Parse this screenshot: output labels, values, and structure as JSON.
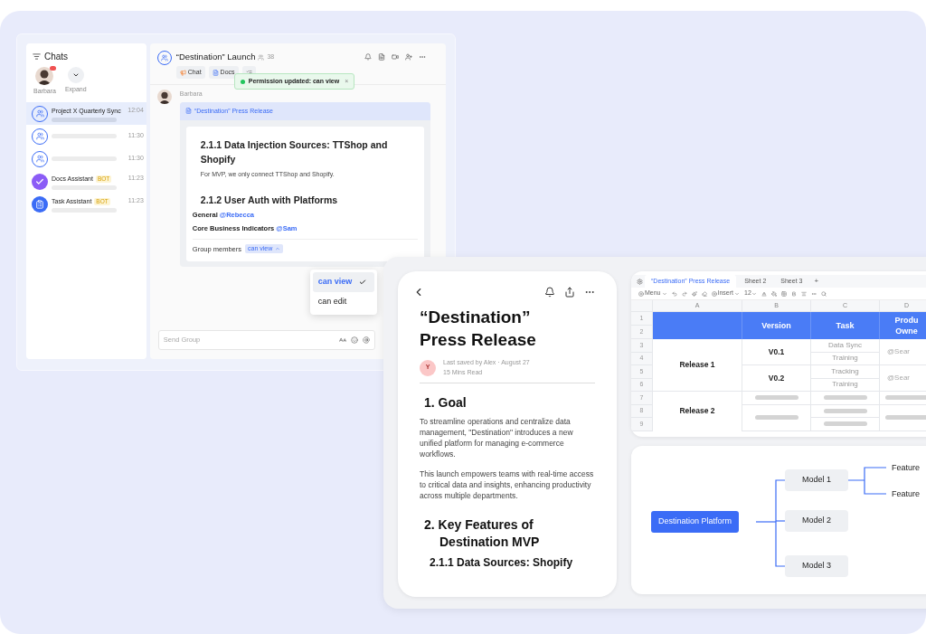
{
  "chat_window": {
    "sidebar": {
      "title": "Chats",
      "quick_contacts": [
        {
          "kind": "avatar",
          "name": "Barbara",
          "badge": true
        },
        {
          "kind": "expand",
          "name": "Expand"
        }
      ],
      "chats": [
        {
          "kind": "group",
          "name": "Project X Quarterly Sync",
          "time": "12:04",
          "selected": true
        },
        {
          "kind": "group",
          "time": "11:30",
          "selected": false
        },
        {
          "kind": "group",
          "time": "11:30",
          "selected": false
        },
        {
          "kind": "docs_bot",
          "name": "Docs Assistant",
          "tag": "BOT",
          "time": "11:23",
          "selected": false
        },
        {
          "kind": "task_bot",
          "name": "Task Assistant",
          "tag": "BOT",
          "time": "11:23",
          "selected": false
        }
      ]
    },
    "header": {
      "title": "“Destination” Launch",
      "member_count": "38",
      "tabs": [
        {
          "kind": "chat",
          "label": "Chat"
        },
        {
          "kind": "docs",
          "label": "Docs"
        },
        {
          "kind": "more"
        }
      ]
    },
    "toast": {
      "text": "Permission updated: can view",
      "close": "×"
    },
    "message": {
      "sender": "Barbara",
      "doc_title": "“Destination” Press Release",
      "heading_1": "2.1.1 Data Injection Sources: TTShop and Shopify",
      "body": "For MVP, we only connect TTShop and Shopify.",
      "heading_2": "2.1.2 User Auth with Platforms",
      "assignments": [
        {
          "label": "General",
          "mention": "@Rebecca"
        },
        {
          "label": "Core Business Indicators",
          "mention": "@Sam"
        }
      ],
      "permission": {
        "label": "Group members",
        "value": "can view"
      }
    },
    "permission_menu": [
      {
        "label": "can view",
        "selected": true
      },
      {
        "label": "can edit",
        "selected": false
      }
    ],
    "composer": {
      "placeholder": "Send Group"
    }
  },
  "document": {
    "title": "“Destination” Press Release",
    "author_initial": "Y",
    "saved": "Last saved by Alex · August 27",
    "read_time": "15 Mins Read",
    "sections": [
      {
        "kind": "heading",
        "text": "1. Goal"
      },
      {
        "kind": "paragraph",
        "text": "To streamline operations and centralize data management, \"Destination\" introduces a new unified platform for managing e-commerce workflows."
      },
      {
        "kind": "paragraph",
        "text": "This launch empowers teams with real-time access to critical data and insights, enhancing productivity across multiple departments."
      },
      {
        "kind": "heading",
        "text": "2. Key Features of Destination MVP"
      },
      {
        "kind": "subheading",
        "text": "2.1.1 Data Sources: Shopify"
      }
    ]
  },
  "spreadsheet": {
    "sheets": [
      {
        "label": "“Destination” Press Release",
        "selected": true
      },
      {
        "label": "Sheet 2",
        "selected": false
      },
      {
        "label": "Sheet 3",
        "selected": false
      }
    ],
    "add_sheet": "+",
    "toolbar": {
      "menu": "Menu",
      "insert": "Insert",
      "font_size": "12"
    },
    "column_letters": [
      "A",
      "B",
      "C",
      "D"
    ],
    "row_numbers": [
      "1",
      "2",
      "3",
      "4",
      "5",
      "6",
      "7",
      "8",
      "9"
    ],
    "column_headers": [
      "Version",
      "Task",
      "Produ\nOwne"
    ],
    "releases": [
      {
        "kind": "filled",
        "name": "Release 1",
        "versions": [
          {
            "name": "V0.1",
            "tasks": [
              "Data Sync",
              "Training"
            ],
            "owner": "@Sear"
          },
          {
            "name": "V0.2",
            "tasks": [
              "Tracking",
              "Training"
            ],
            "owner": "@Sear"
          }
        ]
      },
      {
        "kind": "placeholder",
        "name": "Release 2"
      }
    ]
  },
  "mind_map": {
    "root": "Destination Platform",
    "children": [
      {
        "label": "Model 1",
        "children": [
          {
            "label": "Feature"
          },
          {
            "label": "Feature"
          }
        ]
      },
      {
        "label": "Model 2"
      },
      {
        "label": "Model 3"
      }
    ]
  }
}
